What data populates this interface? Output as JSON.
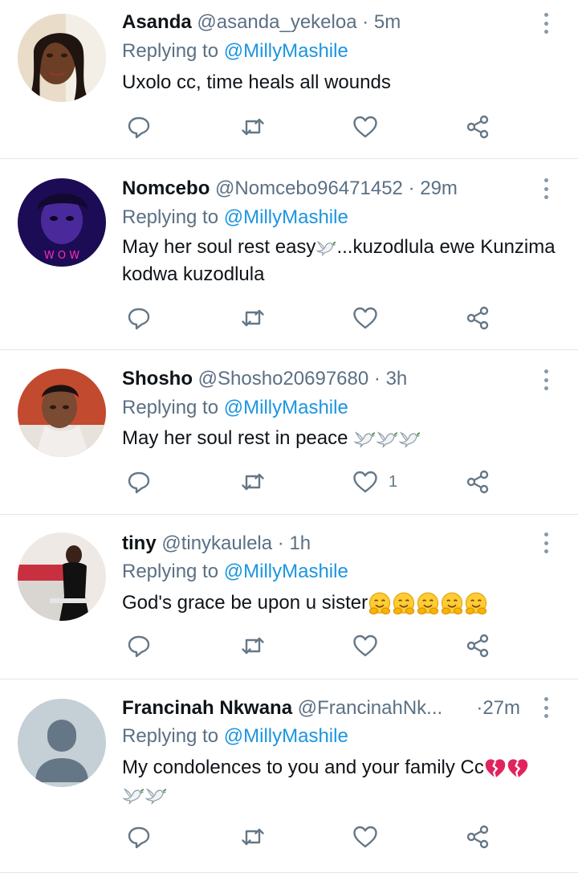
{
  "tweets": [
    {
      "name": "Asanda",
      "handle": "@asanda_yekeloa",
      "time": "5m",
      "reply_prefix": "Replying to",
      "reply_to": "@MillyMashile",
      "text": "Uxolo cc, time heals all wounds",
      "likes": ""
    },
    {
      "name": "Nomcebo",
      "handle": "@Nomcebo96471452",
      "time": "29m",
      "reply_prefix": "Replying to",
      "reply_to": "@MillyMashile",
      "text_a": "May her soul rest easy",
      "text_b": "...kuzodlula ewe Kunzima kodwa kuzodlula",
      "avatar_text": "W O W",
      "likes": ""
    },
    {
      "name": "Shosho",
      "handle": "@Shosho20697680",
      "time": "3h",
      "reply_prefix": "Replying to",
      "reply_to": "@MillyMashile",
      "text": "May her soul rest in peace",
      "likes": "1"
    },
    {
      "name": "tiny",
      "handle": "@tinykaulela",
      "time": "1h",
      "reply_prefix": "Replying to",
      "reply_to": "@MillyMashile",
      "text": "God's grace be upon u sister",
      "likes": ""
    },
    {
      "name": "Francinah Nkwana",
      "handle": "@FrancinahNk...",
      "time": "27m",
      "reply_prefix": "Replying to",
      "reply_to": "@MillyMashile",
      "text": "My condolences to you and your family Cc",
      "likes": ""
    }
  ],
  "icons": {
    "reply": "reply-icon",
    "retweet": "retweet-icon",
    "like": "heart-icon",
    "share": "share-icon",
    "more": "more-vertical-icon"
  },
  "colors": {
    "mention": "#1b95e0",
    "secondary_text": "#5b7083",
    "divider": "#e1e6ea"
  }
}
